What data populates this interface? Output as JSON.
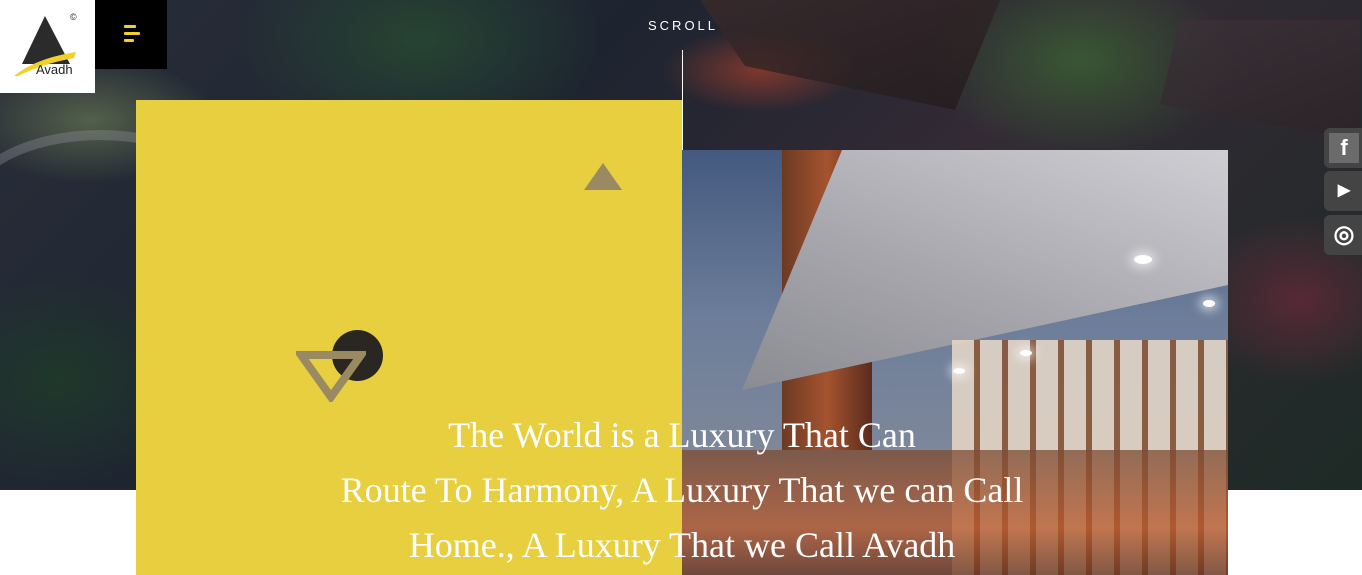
{
  "brand": {
    "name": "Avadh",
    "copyright_mark": "©",
    "logo_icon": "avadh-triangle-logo",
    "accent_color": "#e7cf40"
  },
  "nav": {
    "menu_icon": "hamburger-icon"
  },
  "scroll": {
    "label": "SCROLL"
  },
  "hero": {
    "lines": [
      "The World is a Luxury That Can",
      "Route To Harmony, A Luxury That we can Call",
      "Home., A Luxury That we Call Avadh"
    ]
  },
  "social": [
    {
      "name": "facebook",
      "icon": "facebook-icon",
      "glyph": "f"
    },
    {
      "name": "youtube",
      "icon": "youtube-icon",
      "glyph": "▶"
    },
    {
      "name": "instagram",
      "icon": "instagram-icon",
      "glyph": "◎"
    }
  ]
}
